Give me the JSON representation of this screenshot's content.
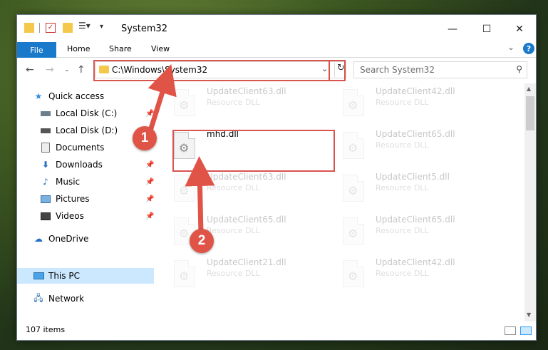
{
  "window": {
    "title": "System32",
    "controls": {
      "minimize": "—",
      "maximize": "☐",
      "close": "✕"
    }
  },
  "ribbon": {
    "file_tab": "File",
    "tabs": [
      "Home",
      "Share",
      "View"
    ]
  },
  "nav": {
    "address_path": "C:\\Windows\\System32",
    "search_placeholder": "Search System32"
  },
  "sidebar": {
    "items": [
      {
        "label": "Quick access",
        "icon": "star-icon"
      },
      {
        "label": "Local Disk (C:)",
        "icon": "drive-icon",
        "pinned": true
      },
      {
        "label": "Local Disk (D:)",
        "icon": "drive-icon"
      },
      {
        "label": "Documents",
        "icon": "documents-icon"
      },
      {
        "label": "Downloads",
        "icon": "downloads-icon",
        "pinned": true
      },
      {
        "label": "Music",
        "icon": "music-icon",
        "pinned": true
      },
      {
        "label": "Pictures",
        "icon": "pictures-icon",
        "pinned": true
      },
      {
        "label": "Videos",
        "icon": "videos-icon",
        "pinned": true
      },
      {
        "label": "OneDrive",
        "icon": "cloud-icon"
      },
      {
        "label": "This PC",
        "icon": "pc-icon",
        "selected": true
      },
      {
        "label": "Network",
        "icon": "network-icon"
      }
    ]
  },
  "files": [
    {
      "name": "UpdateClient63.dll",
      "type": "Resource DLL"
    },
    {
      "name": "UpdateClient42.dll",
      "type": "Resource DLL"
    },
    {
      "name": "mhd.dll",
      "type": ""
    },
    {
      "name": "UpdateClient65.dll",
      "type": "Resource DLL"
    },
    {
      "name": "UpdateClient63.dll",
      "type": "Resource DLL"
    },
    {
      "name": "UpdateClient5.dll",
      "type": "Resource DLL"
    },
    {
      "name": "UpdateClient65.dll",
      "type": "Resource DLL"
    },
    {
      "name": "UpdateClient65.dll",
      "type": "Resource DLL"
    },
    {
      "name": "UpdateClient21.dll",
      "type": "Resource DLL"
    },
    {
      "name": "UpdateClient42.dll",
      "type": "Resource DLL"
    }
  ],
  "status": {
    "item_count": "107 items"
  },
  "annotations": {
    "step1": "1",
    "step2": "2",
    "color": "#e05347"
  }
}
